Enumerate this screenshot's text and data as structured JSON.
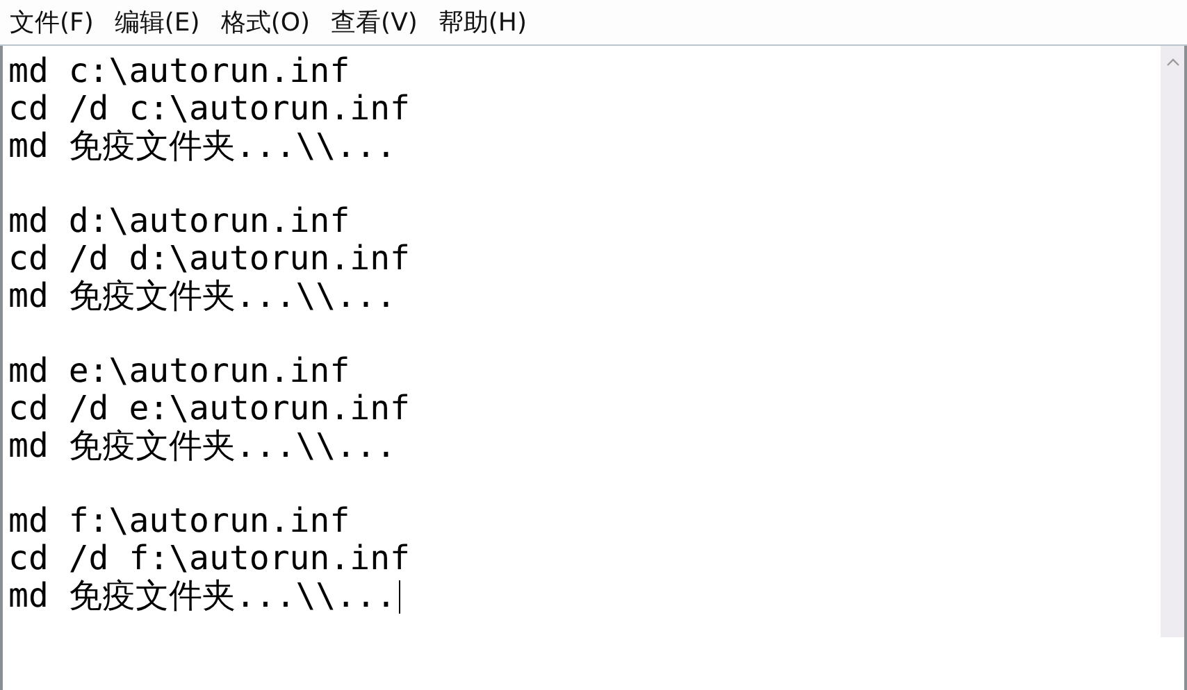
{
  "menu": [
    {
      "label": "文件(F)"
    },
    {
      "label": "编辑(E)"
    },
    {
      "label": "格式(O)"
    },
    {
      "label": "查看(V)"
    },
    {
      "label": "帮助(H)"
    }
  ],
  "editor": {
    "caret_at_end": true,
    "blocks": [
      [
        "md c:\\autorun.inf",
        "cd /d c:\\autorun.inf",
        "md 免疫文件夹...\\\\..."
      ],
      [
        "md d:\\autorun.inf",
        "cd /d d:\\autorun.inf",
        "md 免疫文件夹...\\\\..."
      ],
      [
        "md e:\\autorun.inf",
        "cd /d e:\\autorun.inf",
        "md 免疫文件夹...\\\\..."
      ],
      [
        "md f:\\autorun.inf",
        "cd /d f:\\autorun.inf",
        "md 免疫文件夹...\\\\..."
      ]
    ]
  }
}
